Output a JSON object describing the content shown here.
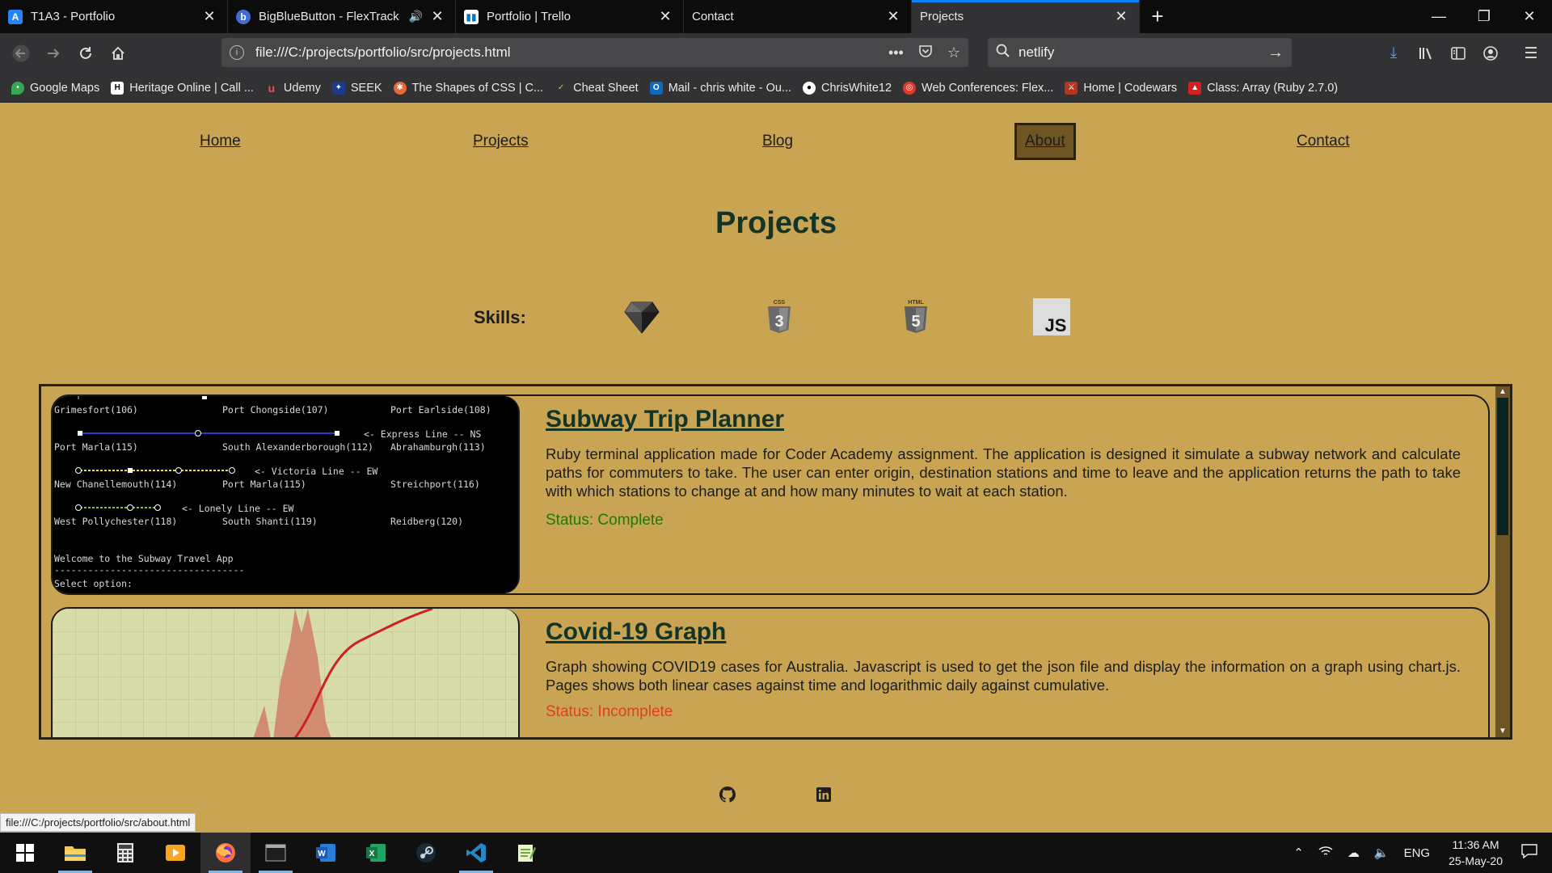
{
  "browser": {
    "tabs": [
      {
        "title": "T1A3 - Portfolio",
        "active": false
      },
      {
        "title": "BigBlueButton - FlexTrack -",
        "active": false,
        "audio": true
      },
      {
        "title": "Portfolio | Trello",
        "active": false
      },
      {
        "title": "Contact",
        "active": false
      },
      {
        "title": "Projects",
        "active": true
      }
    ],
    "url": "file:///C:/projects/portfolio/src/projects.html",
    "search_value": "netlify",
    "bookmarks": [
      "Google Maps",
      "Heritage Online | Call ...",
      "Udemy",
      "SEEK",
      "The Shapes of CSS | C...",
      "Cheat Sheet",
      "Mail - chris white - Ou...",
      "ChrisWhite12",
      "Web Conferences: Flex...",
      "Home | Codewars",
      "Class: Array (Ruby 2.7.0)"
    ],
    "status_link": "file:///C:/projects/portfolio/src/about.html"
  },
  "site": {
    "nav": [
      "Home",
      "Projects",
      "Blog",
      "About",
      "Contact"
    ],
    "active_nav": "About",
    "title": "Projects",
    "skills_label": "Skills:",
    "skills": [
      "ruby-icon",
      "css3-icon",
      "html5-icon",
      "javascript-icon"
    ],
    "skill_badges": {
      "css": "CSS",
      "html": "HTML",
      "js": "JS"
    },
    "projects": [
      {
        "title": "Subway Trip Planner",
        "description": "Ruby terminal application made for Coder Academy assignment. The application is designed it simulate a subway network and calculate paths for commuters to take. The user can enter origin, destination stations and time to leave and the application returns the path to take with which stations to change at and how many minutes to wait at each station.",
        "status": "Status: Complete",
        "status_color": "#127e0c",
        "terminal_lines": [
          "Grimesfort(106)",
          "Port Chongside(107)",
          "Port Earlside(108)",
          "<- Express Line -- NS",
          "Port Marla(115)",
          "South Alexanderborough(112)",
          "Abrahamburgh(113)",
          "<- Victoria Line -- EW",
          "New Chanellemouth(114)",
          "Port Marla(115)",
          "Streichport(116)",
          "<- Lonely Line -- EW",
          "West Pollychester(118)",
          "South Shanti(119)",
          "Reidberg(120)",
          "Welcome to the Subway Travel App",
          "----------------------------------",
          "Select option:"
        ]
      },
      {
        "title": "Covid-19 Graph",
        "description": "Graph showing COVID19 cases for Australia. Javascript is used to get the json file and display the information on a graph using chart.js. Pages shows both linear cases against time and logarithmic daily against cumulative.",
        "status": "Status: Incomplete",
        "status_color": "#e0401d"
      }
    ],
    "footer_icons": [
      "github-icon",
      "linkedin-icon"
    ]
  },
  "taskbar": {
    "apps": [
      "start-icon",
      "file-explorer-icon",
      "calculator-icon",
      "media-player-icon",
      "firefox-icon",
      "terminal-icon",
      "word-icon",
      "excel-icon",
      "steam-icon",
      "vscode-icon",
      "notepad-icon"
    ],
    "lang": "ENG",
    "time": "11:36 AM",
    "date": "25-May-20"
  }
}
